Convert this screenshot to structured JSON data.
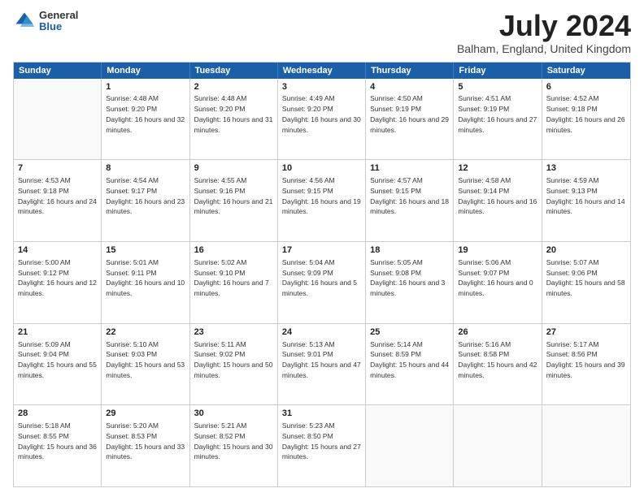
{
  "logo": {
    "general": "General",
    "blue": "Blue"
  },
  "title": "July 2024",
  "location": "Balham, England, United Kingdom",
  "header_days": [
    "Sunday",
    "Monday",
    "Tuesday",
    "Wednesday",
    "Thursday",
    "Friday",
    "Saturday"
  ],
  "weeks": [
    [
      {
        "day": "",
        "sunrise": "",
        "sunset": "",
        "daylight": ""
      },
      {
        "day": "1",
        "sunrise": "Sunrise: 4:48 AM",
        "sunset": "Sunset: 9:20 PM",
        "daylight": "Daylight: 16 hours and 32 minutes."
      },
      {
        "day": "2",
        "sunrise": "Sunrise: 4:48 AM",
        "sunset": "Sunset: 9:20 PM",
        "daylight": "Daylight: 16 hours and 31 minutes."
      },
      {
        "day": "3",
        "sunrise": "Sunrise: 4:49 AM",
        "sunset": "Sunset: 9:20 PM",
        "daylight": "Daylight: 16 hours and 30 minutes."
      },
      {
        "day": "4",
        "sunrise": "Sunrise: 4:50 AM",
        "sunset": "Sunset: 9:19 PM",
        "daylight": "Daylight: 16 hours and 29 minutes."
      },
      {
        "day": "5",
        "sunrise": "Sunrise: 4:51 AM",
        "sunset": "Sunset: 9:19 PM",
        "daylight": "Daylight: 16 hours and 27 minutes."
      },
      {
        "day": "6",
        "sunrise": "Sunrise: 4:52 AM",
        "sunset": "Sunset: 9:18 PM",
        "daylight": "Daylight: 16 hours and 26 minutes."
      }
    ],
    [
      {
        "day": "7",
        "sunrise": "Sunrise: 4:53 AM",
        "sunset": "Sunset: 9:18 PM",
        "daylight": "Daylight: 16 hours and 24 minutes."
      },
      {
        "day": "8",
        "sunrise": "Sunrise: 4:54 AM",
        "sunset": "Sunset: 9:17 PM",
        "daylight": "Daylight: 16 hours and 23 minutes."
      },
      {
        "day": "9",
        "sunrise": "Sunrise: 4:55 AM",
        "sunset": "Sunset: 9:16 PM",
        "daylight": "Daylight: 16 hours and 21 minutes."
      },
      {
        "day": "10",
        "sunrise": "Sunrise: 4:56 AM",
        "sunset": "Sunset: 9:15 PM",
        "daylight": "Daylight: 16 hours and 19 minutes."
      },
      {
        "day": "11",
        "sunrise": "Sunrise: 4:57 AM",
        "sunset": "Sunset: 9:15 PM",
        "daylight": "Daylight: 16 hours and 18 minutes."
      },
      {
        "day": "12",
        "sunrise": "Sunrise: 4:58 AM",
        "sunset": "Sunset: 9:14 PM",
        "daylight": "Daylight: 16 hours and 16 minutes."
      },
      {
        "day": "13",
        "sunrise": "Sunrise: 4:59 AM",
        "sunset": "Sunset: 9:13 PM",
        "daylight": "Daylight: 16 hours and 14 minutes."
      }
    ],
    [
      {
        "day": "14",
        "sunrise": "Sunrise: 5:00 AM",
        "sunset": "Sunset: 9:12 PM",
        "daylight": "Daylight: 16 hours and 12 minutes."
      },
      {
        "day": "15",
        "sunrise": "Sunrise: 5:01 AM",
        "sunset": "Sunset: 9:11 PM",
        "daylight": "Daylight: 16 hours and 10 minutes."
      },
      {
        "day": "16",
        "sunrise": "Sunrise: 5:02 AM",
        "sunset": "Sunset: 9:10 PM",
        "daylight": "Daylight: 16 hours and 7 minutes."
      },
      {
        "day": "17",
        "sunrise": "Sunrise: 5:04 AM",
        "sunset": "Sunset: 9:09 PM",
        "daylight": "Daylight: 16 hours and 5 minutes."
      },
      {
        "day": "18",
        "sunrise": "Sunrise: 5:05 AM",
        "sunset": "Sunset: 9:08 PM",
        "daylight": "Daylight: 16 hours and 3 minutes."
      },
      {
        "day": "19",
        "sunrise": "Sunrise: 5:06 AM",
        "sunset": "Sunset: 9:07 PM",
        "daylight": "Daylight: 16 hours and 0 minutes."
      },
      {
        "day": "20",
        "sunrise": "Sunrise: 5:07 AM",
        "sunset": "Sunset: 9:06 PM",
        "daylight": "Daylight: 15 hours and 58 minutes."
      }
    ],
    [
      {
        "day": "21",
        "sunrise": "Sunrise: 5:09 AM",
        "sunset": "Sunset: 9:04 PM",
        "daylight": "Daylight: 15 hours and 55 minutes."
      },
      {
        "day": "22",
        "sunrise": "Sunrise: 5:10 AM",
        "sunset": "Sunset: 9:03 PM",
        "daylight": "Daylight: 15 hours and 53 minutes."
      },
      {
        "day": "23",
        "sunrise": "Sunrise: 5:11 AM",
        "sunset": "Sunset: 9:02 PM",
        "daylight": "Daylight: 15 hours and 50 minutes."
      },
      {
        "day": "24",
        "sunrise": "Sunrise: 5:13 AM",
        "sunset": "Sunset: 9:01 PM",
        "daylight": "Daylight: 15 hours and 47 minutes."
      },
      {
        "day": "25",
        "sunrise": "Sunrise: 5:14 AM",
        "sunset": "Sunset: 8:59 PM",
        "daylight": "Daylight: 15 hours and 44 minutes."
      },
      {
        "day": "26",
        "sunrise": "Sunrise: 5:16 AM",
        "sunset": "Sunset: 8:58 PM",
        "daylight": "Daylight: 15 hours and 42 minutes."
      },
      {
        "day": "27",
        "sunrise": "Sunrise: 5:17 AM",
        "sunset": "Sunset: 8:56 PM",
        "daylight": "Daylight: 15 hours and 39 minutes."
      }
    ],
    [
      {
        "day": "28",
        "sunrise": "Sunrise: 5:18 AM",
        "sunset": "Sunset: 8:55 PM",
        "daylight": "Daylight: 15 hours and 36 minutes."
      },
      {
        "day": "29",
        "sunrise": "Sunrise: 5:20 AM",
        "sunset": "Sunset: 8:53 PM",
        "daylight": "Daylight: 15 hours and 33 minutes."
      },
      {
        "day": "30",
        "sunrise": "Sunrise: 5:21 AM",
        "sunset": "Sunset: 8:52 PM",
        "daylight": "Daylight: 15 hours and 30 minutes."
      },
      {
        "day": "31",
        "sunrise": "Sunrise: 5:23 AM",
        "sunset": "Sunset: 8:50 PM",
        "daylight": "Daylight: 15 hours and 27 minutes."
      },
      {
        "day": "",
        "sunrise": "",
        "sunset": "",
        "daylight": ""
      },
      {
        "day": "",
        "sunrise": "",
        "sunset": "",
        "daylight": ""
      },
      {
        "day": "",
        "sunrise": "",
        "sunset": "",
        "daylight": ""
      }
    ]
  ]
}
